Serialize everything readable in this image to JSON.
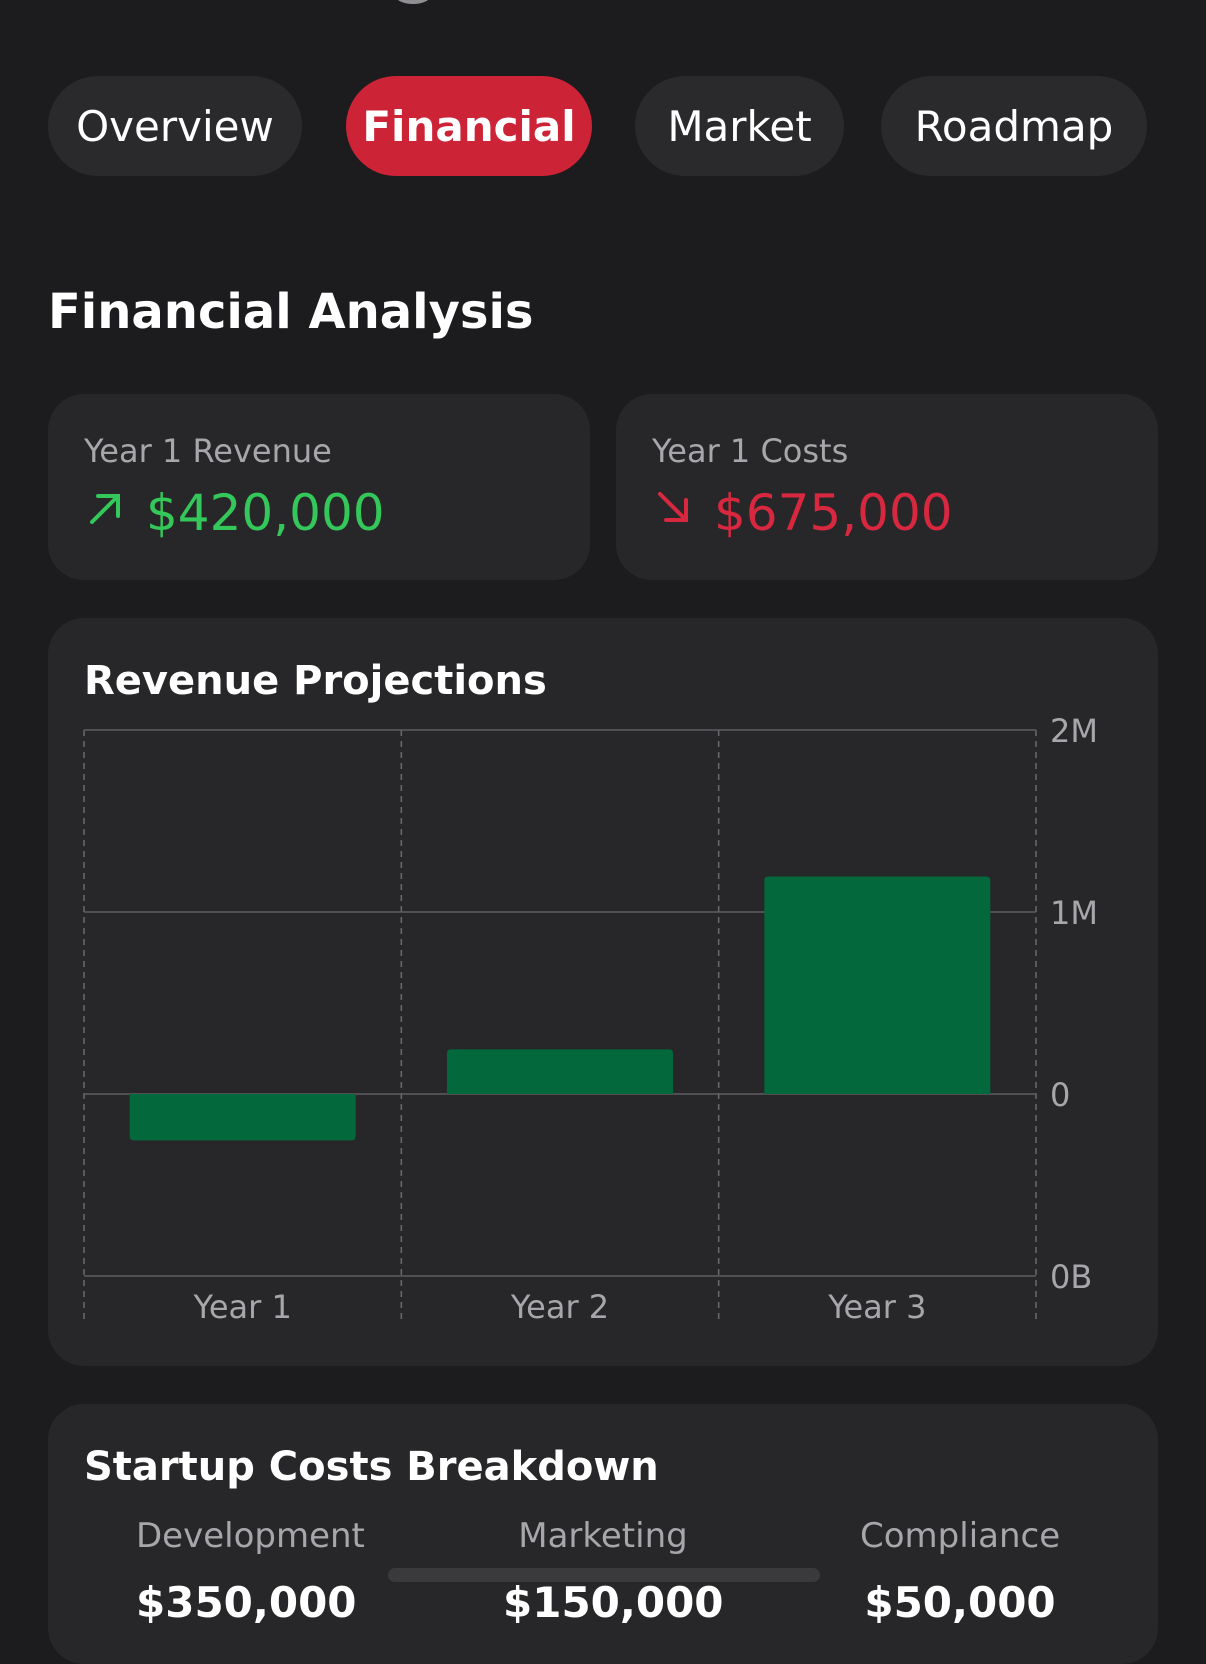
{
  "tabs": [
    {
      "label": "Overview",
      "active": false
    },
    {
      "label": "Financial",
      "active": true
    },
    {
      "label": "Market",
      "active": false
    },
    {
      "label": "Roadmap",
      "active": false
    }
  ],
  "section_title": "Financial Analysis",
  "stats": {
    "revenue": {
      "label": "Year 1 Revenue",
      "value": "$420,000",
      "icon": "arrow-up-right-icon",
      "color": "#34c759"
    },
    "costs": {
      "label": "Year 1 Costs",
      "value": "$675,000",
      "icon": "arrow-down-right-icon",
      "color": "#d8283f"
    }
  },
  "chart_card": {
    "title": "Revenue Projections"
  },
  "chart_data": {
    "type": "bar",
    "title": "Revenue Projections",
    "categories": [
      "Year 1",
      "Year 2",
      "Year 3"
    ],
    "values": [
      -255000,
      245000,
      1195000
    ],
    "y_ticks": [
      {
        "value": -1000000,
        "label": "0B"
      },
      {
        "value": 0,
        "label": "0"
      },
      {
        "value": 1000000,
        "label": "1M"
      },
      {
        "value": 2000000,
        "label": "2M"
      }
    ],
    "ylim": [
      -1000000,
      2000000
    ],
    "bar_color": "#03693d",
    "grid": true
  },
  "costs": {
    "title": "Startup Costs Breakdown",
    "items": [
      {
        "label": "Development",
        "value": "$350,000"
      },
      {
        "label": "Marketing",
        "value": "$150,000"
      },
      {
        "label": "Compliance",
        "value": "$50,000"
      }
    ]
  }
}
